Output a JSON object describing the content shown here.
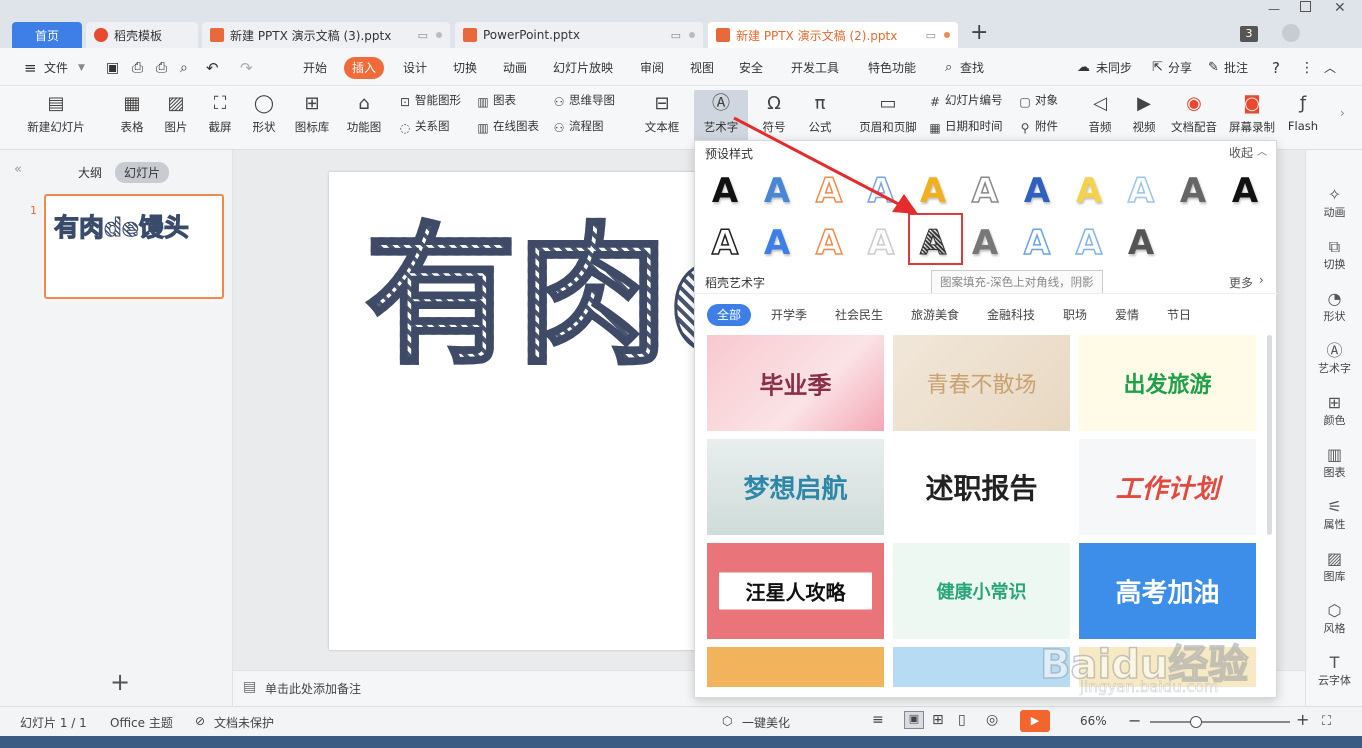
{
  "tabs": [
    {
      "label": "首页"
    },
    {
      "label": "稻壳模板"
    },
    {
      "label": "新建 PPTX 演示文稿 (3).pptx"
    },
    {
      "label": "PowerPoint.pptx"
    },
    {
      "label": "新建 PPTX 演示文稿 (2).pptx"
    }
  ],
  "tab_new": "+",
  "window_badge": "3",
  "menu": {
    "file": "文件",
    "items": [
      "开始",
      "插入",
      "设计",
      "切换",
      "动画",
      "幻灯片放映",
      "审阅",
      "视图",
      "安全",
      "开发工具",
      "特色功能"
    ],
    "search": "查找",
    "sync": "未同步",
    "share": "分享",
    "comment": "批注",
    "help": "?"
  },
  "toolbar": {
    "new_slide": "新建幻灯片",
    "table": "表格",
    "picture": "图片",
    "screenshot": "截屏",
    "shape": "形状",
    "icon_lib": "图标库",
    "func_chart": "功能图",
    "smart_shape": "智能图形",
    "chart": "图表",
    "relation": "关系图",
    "online_chart": "在线图表",
    "mindmap": "思维导图",
    "flowchart": "流程图",
    "textbox": "文本框",
    "wordart": "艺术字",
    "symbol": "符号",
    "formula": "公式",
    "header_footer": "页眉和页脚",
    "slide_number": "幻灯片编号",
    "object": "对象",
    "date_time": "日期和时间",
    "attachment": "附件",
    "audio": "音频",
    "video": "视频",
    "doc_audio": "文档配音",
    "screen_record": "屏幕录制",
    "flash": "Flash"
  },
  "left_pane": {
    "outline_tab": "大纲",
    "slides_tab": "幻灯片",
    "thumb_number": "1",
    "thumb_text": "有肉de馒头",
    "add": "+"
  },
  "slide": {
    "title": "有肉d"
  },
  "notes_placeholder": "单击此处添加备注",
  "right_pane": [
    "动画",
    "切换",
    "形状",
    "艺术字",
    "颜色",
    "图表",
    "属性",
    "图库",
    "风格",
    "云字体"
  ],
  "wordart_popup": {
    "preset_label": "预设样式",
    "collapse": "收起",
    "tooltip": "图案填充-深色上对角线，阴影",
    "shell_label": "稻壳艺术字",
    "more": "更多",
    "categories": [
      "全部",
      "开学季",
      "社会民生",
      "旅游美食",
      "金融科技",
      "职场",
      "爱情",
      "节日"
    ],
    "cards": [
      "毕业季",
      "青春不散场",
      "出发旅游",
      "梦想启航",
      "述职报告",
      "工作计划",
      "汪星人攻略",
      "健康小常识",
      "高考加油"
    ],
    "preset_colors": [
      "#111111",
      "#4a86d6",
      "#f08a4b",
      "#7aa3dd",
      "#f2b01e",
      "#888888",
      "#2f5fbf",
      "#f4d24a",
      "#9cc4ec",
      "#666666",
      "#111111",
      "#222222",
      "#3d7fe6",
      "#f08a4b",
      "#cccccc",
      "#555555",
      "#777777",
      "#6aa3e6",
      "#7fb2ef",
      "#555555"
    ]
  },
  "status": {
    "slide_counter": "幻灯片 1 / 1",
    "theme": "Office 主题",
    "protect": "文档未保护",
    "beautify": "一键美化",
    "zoom": "66%",
    "zoom_level": 0.33
  },
  "watermark": {
    "brand": "Baidu经验",
    "url": "jingyan.baidu.com"
  }
}
